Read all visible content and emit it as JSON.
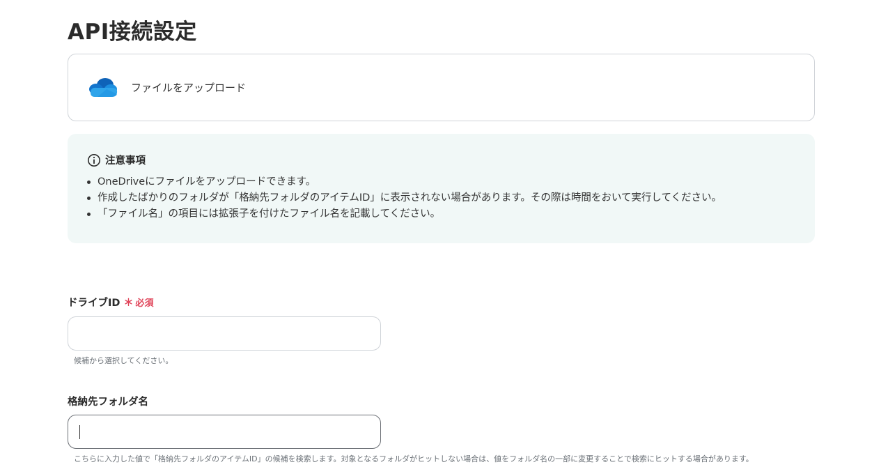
{
  "page": {
    "title": "API接続設定"
  },
  "action": {
    "app_icon": "onedrive-cloud-icon",
    "label": "ファイルをアップロード"
  },
  "notice": {
    "icon": "info-circle-icon",
    "title": "注意事項",
    "items": [
      "OneDriveにファイルをアップロードできます。",
      "作成したばかりのフォルダが「格納先フォルダのアイテムID」に表示されない場合があります。その際は時間をおいて実行してください。",
      "「ファイル名」の項目には拡張子を付けたファイル名を記載してください。"
    ]
  },
  "fields": {
    "drive_id": {
      "label": "ドライブID",
      "required_mark": "＊",
      "required_text": "必須",
      "value": "",
      "placeholder": "",
      "hint": "候補から選択してください。"
    },
    "folder_name": {
      "label": "格納先フォルダ名",
      "value": "",
      "placeholder": "",
      "hint": "こちらに入力した値で「格納先フォルダのアイテムID」の候補を検索します。対象となるフォルダがヒットしない場合は、値をフォルダ名の一部に変更することで検索にヒットする場合があります。"
    }
  },
  "colors": {
    "notice_bg": "#f1f8f7",
    "required": "#e0455a",
    "border": "#cfd3d8",
    "onedrive_dark": "#0f63b8",
    "onedrive_light": "#2fa4ea"
  }
}
